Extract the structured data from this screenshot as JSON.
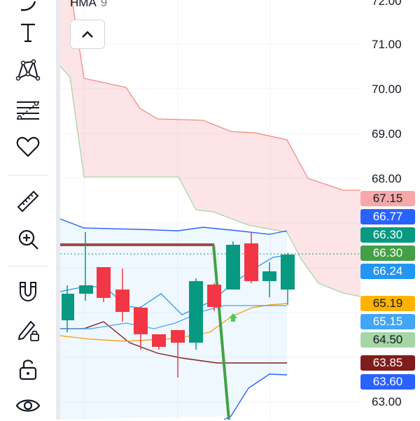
{
  "indicator": {
    "name": "HMA",
    "value": "9"
  },
  "toolbar": {
    "tools": [
      {
        "name": "text-tool",
        "icon": "text-icon"
      },
      {
        "name": "pattern-tool",
        "icon": "xabcd-pattern-icon"
      },
      {
        "name": "fib-tool",
        "icon": "fib-retracement-icon"
      },
      {
        "name": "favorites-tool",
        "icon": "heart-icon"
      },
      {
        "name": "measure-tool",
        "icon": "ruler-icon"
      },
      {
        "name": "zoom-tool",
        "icon": "zoom-in-icon"
      },
      {
        "name": "magnet-tool",
        "icon": "magnet-icon"
      },
      {
        "name": "lock-drawing-tool",
        "icon": "pencil-lock-icon"
      },
      {
        "name": "lock-all-tool",
        "icon": "unlock-icon"
      },
      {
        "name": "hide-tool",
        "icon": "eye-icon"
      }
    ]
  },
  "price_axis": {
    "labels": [
      "72.00",
      "71.00",
      "70.00",
      "69.00",
      "68.00",
      "63.00"
    ],
    "tags": [
      {
        "text": "67.15",
        "color": "#f7a9a9",
        "text_color": "#131722"
      },
      {
        "text": "66.77",
        "color": "#2962ff",
        "text_color": "#ffffff"
      },
      {
        "text": "66.30",
        "color": "#089981",
        "text_color": "#ffffff"
      },
      {
        "text": "66.30",
        "color": "#43a047",
        "text_color": "#ffffff"
      },
      {
        "text": "66.24",
        "color": "#2196f3",
        "text_color": "#ffffff"
      },
      {
        "text": "65.19",
        "color": "#ffb300",
        "text_color": "#131722"
      },
      {
        "text": "65.15",
        "color": "#42a5f5",
        "text_color": "#ffffff"
      },
      {
        "text": "64.50",
        "color": "#a5d6a7",
        "text_color": "#131722"
      },
      {
        "text": "63.85",
        "color": "#7f1d1d",
        "text_color": "#ffffff"
      },
      {
        "text": "63.60",
        "color": "#2962ff",
        "text_color": "#ffffff"
      }
    ]
  },
  "colors": {
    "up": "#089981",
    "down": "#f23645",
    "cloud_upper": "#f28b82",
    "cloud_lower": "#a5d6a7"
  },
  "chart_data": {
    "type": "candlestick",
    "candles": [
      {
        "o": 64.9,
        "h": 65.3,
        "l": 64.4,
        "c": 65.5
      },
      {
        "o": 65.1,
        "h": 66.3,
        "l": 64.9,
        "c": 65.3
      },
      {
        "o": 65.6,
        "h": 65.6,
        "l": 64.9,
        "c": 65.0
      },
      {
        "o": 65.2,
        "h": 65.4,
        "l": 64.6,
        "c": 64.7
      },
      {
        "o": 64.7,
        "h": 64.8,
        "l": 63.9,
        "c": 64.1
      },
      {
        "o": 64.1,
        "h": 64.2,
        "l": 63.8,
        "c": 63.8
      },
      {
        "o": 64.1,
        "h": 64.3,
        "l": 63.5,
        "c": 63.8
      },
      {
        "o": 63.9,
        "h": 65.4,
        "l": 63.9,
        "c": 65.3
      },
      {
        "o": 65.3,
        "h": 65.3,
        "l": 64.8,
        "c": 64.8
      },
      {
        "o": 65.2,
        "h": 66.2,
        "l": 65.1,
        "c": 66.1
      },
      {
        "o": 66.2,
        "h": 66.3,
        "l": 65.3,
        "c": 65.4
      },
      {
        "o": 65.6,
        "h": 66.0,
        "l": 65.1,
        "c": 65.4
      },
      {
        "o": 65.3,
        "h": 65.9,
        "l": 65.3,
        "c": 65.9
      }
    ]
  }
}
